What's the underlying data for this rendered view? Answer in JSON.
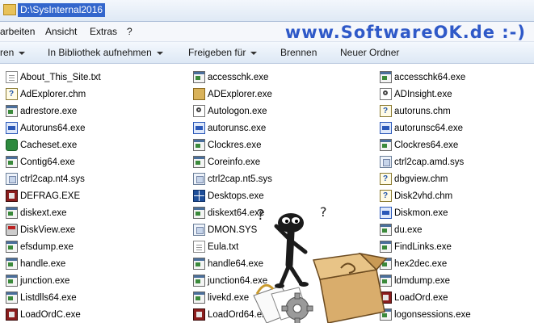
{
  "address": {
    "path": "D:\\SysInternal2016"
  },
  "menu": {
    "items": [
      "arbeiten",
      "Ansicht",
      "Extras",
      "?"
    ]
  },
  "watermark": "www.SoftwareOK.de :-)",
  "toolbar": {
    "organize_fragment": "ren",
    "library": "In Bibliothek aufnehmen",
    "share": "Freigeben für",
    "burn": "Brennen",
    "new_folder": "Neuer Ordner"
  },
  "columns": [
    [
      {
        "name": "About_This_Site.txt",
        "icon": "txt"
      },
      {
        "name": "AdExplorer.chm",
        "icon": "chm"
      },
      {
        "name": "adrestore.exe",
        "icon": "exe"
      },
      {
        "name": "Autoruns64.exe",
        "icon": "blue"
      },
      {
        "name": "Cacheset.exe",
        "icon": "green"
      },
      {
        "name": "Contig64.exe",
        "icon": "exe"
      },
      {
        "name": "ctrl2cap.nt4.sys",
        "icon": "sys"
      },
      {
        "name": "DEFRAG.EXE",
        "icon": "red"
      },
      {
        "name": "diskext.exe",
        "icon": "exe"
      },
      {
        "name": "DiskView.exe",
        "icon": "disk"
      },
      {
        "name": "efsdump.exe",
        "icon": "exe"
      },
      {
        "name": "handle.exe",
        "icon": "exe"
      },
      {
        "name": "junction.exe",
        "icon": "exe"
      },
      {
        "name": "Listdlls64.exe",
        "icon": "exe"
      },
      {
        "name": "LoadOrdC.exe",
        "icon": "red"
      }
    ],
    [
      {
        "name": "accesschk.exe",
        "icon": "exe"
      },
      {
        "name": "ADExplorer.exe",
        "icon": "book"
      },
      {
        "name": "Autologon.exe",
        "icon": "magn"
      },
      {
        "name": "autorunsc.exe",
        "icon": "blue"
      },
      {
        "name": "Clockres.exe",
        "icon": "exe"
      },
      {
        "name": "Coreinfo.exe",
        "icon": "exe"
      },
      {
        "name": "ctrl2cap.nt5.sys",
        "icon": "sys"
      },
      {
        "name": "Desktops.exe",
        "icon": "grid"
      },
      {
        "name": "diskext64.exe",
        "icon": "exe"
      },
      {
        "name": "DMON.SYS",
        "icon": "sys"
      },
      {
        "name": "Eula.txt",
        "icon": "txt"
      },
      {
        "name": "handle64.exe",
        "icon": "exe"
      },
      {
        "name": "junction64.exe",
        "icon": "exe"
      },
      {
        "name": "livekd.exe",
        "icon": "exe"
      },
      {
        "name": "LoadOrd64.exe",
        "icon": "red"
      }
    ],
    [
      {
        "name": "accesschk64.exe",
        "icon": "exe"
      },
      {
        "name": "ADInsight.exe",
        "icon": "magn"
      },
      {
        "name": "autoruns.chm",
        "icon": "chm"
      },
      {
        "name": "autorunsc64.exe",
        "icon": "blue"
      },
      {
        "name": "Clockres64.exe",
        "icon": "exe"
      },
      {
        "name": "ctrl2cap.amd.sys",
        "icon": "sys"
      },
      {
        "name": "dbgview.chm",
        "icon": "chm"
      },
      {
        "name": "Disk2vhd.chm",
        "icon": "chm"
      },
      {
        "name": "Diskmon.exe",
        "icon": "blue"
      },
      {
        "name": "du.exe",
        "icon": "exe"
      },
      {
        "name": "FindLinks.exe",
        "icon": "exe"
      },
      {
        "name": "hex2dec.exe",
        "icon": "exe"
      },
      {
        "name": "ldmdump.exe",
        "icon": "exe"
      },
      {
        "name": "LoadOrd.exe",
        "icon": "red"
      },
      {
        "name": "logonsessions.exe",
        "icon": "exe"
      }
    ]
  ]
}
